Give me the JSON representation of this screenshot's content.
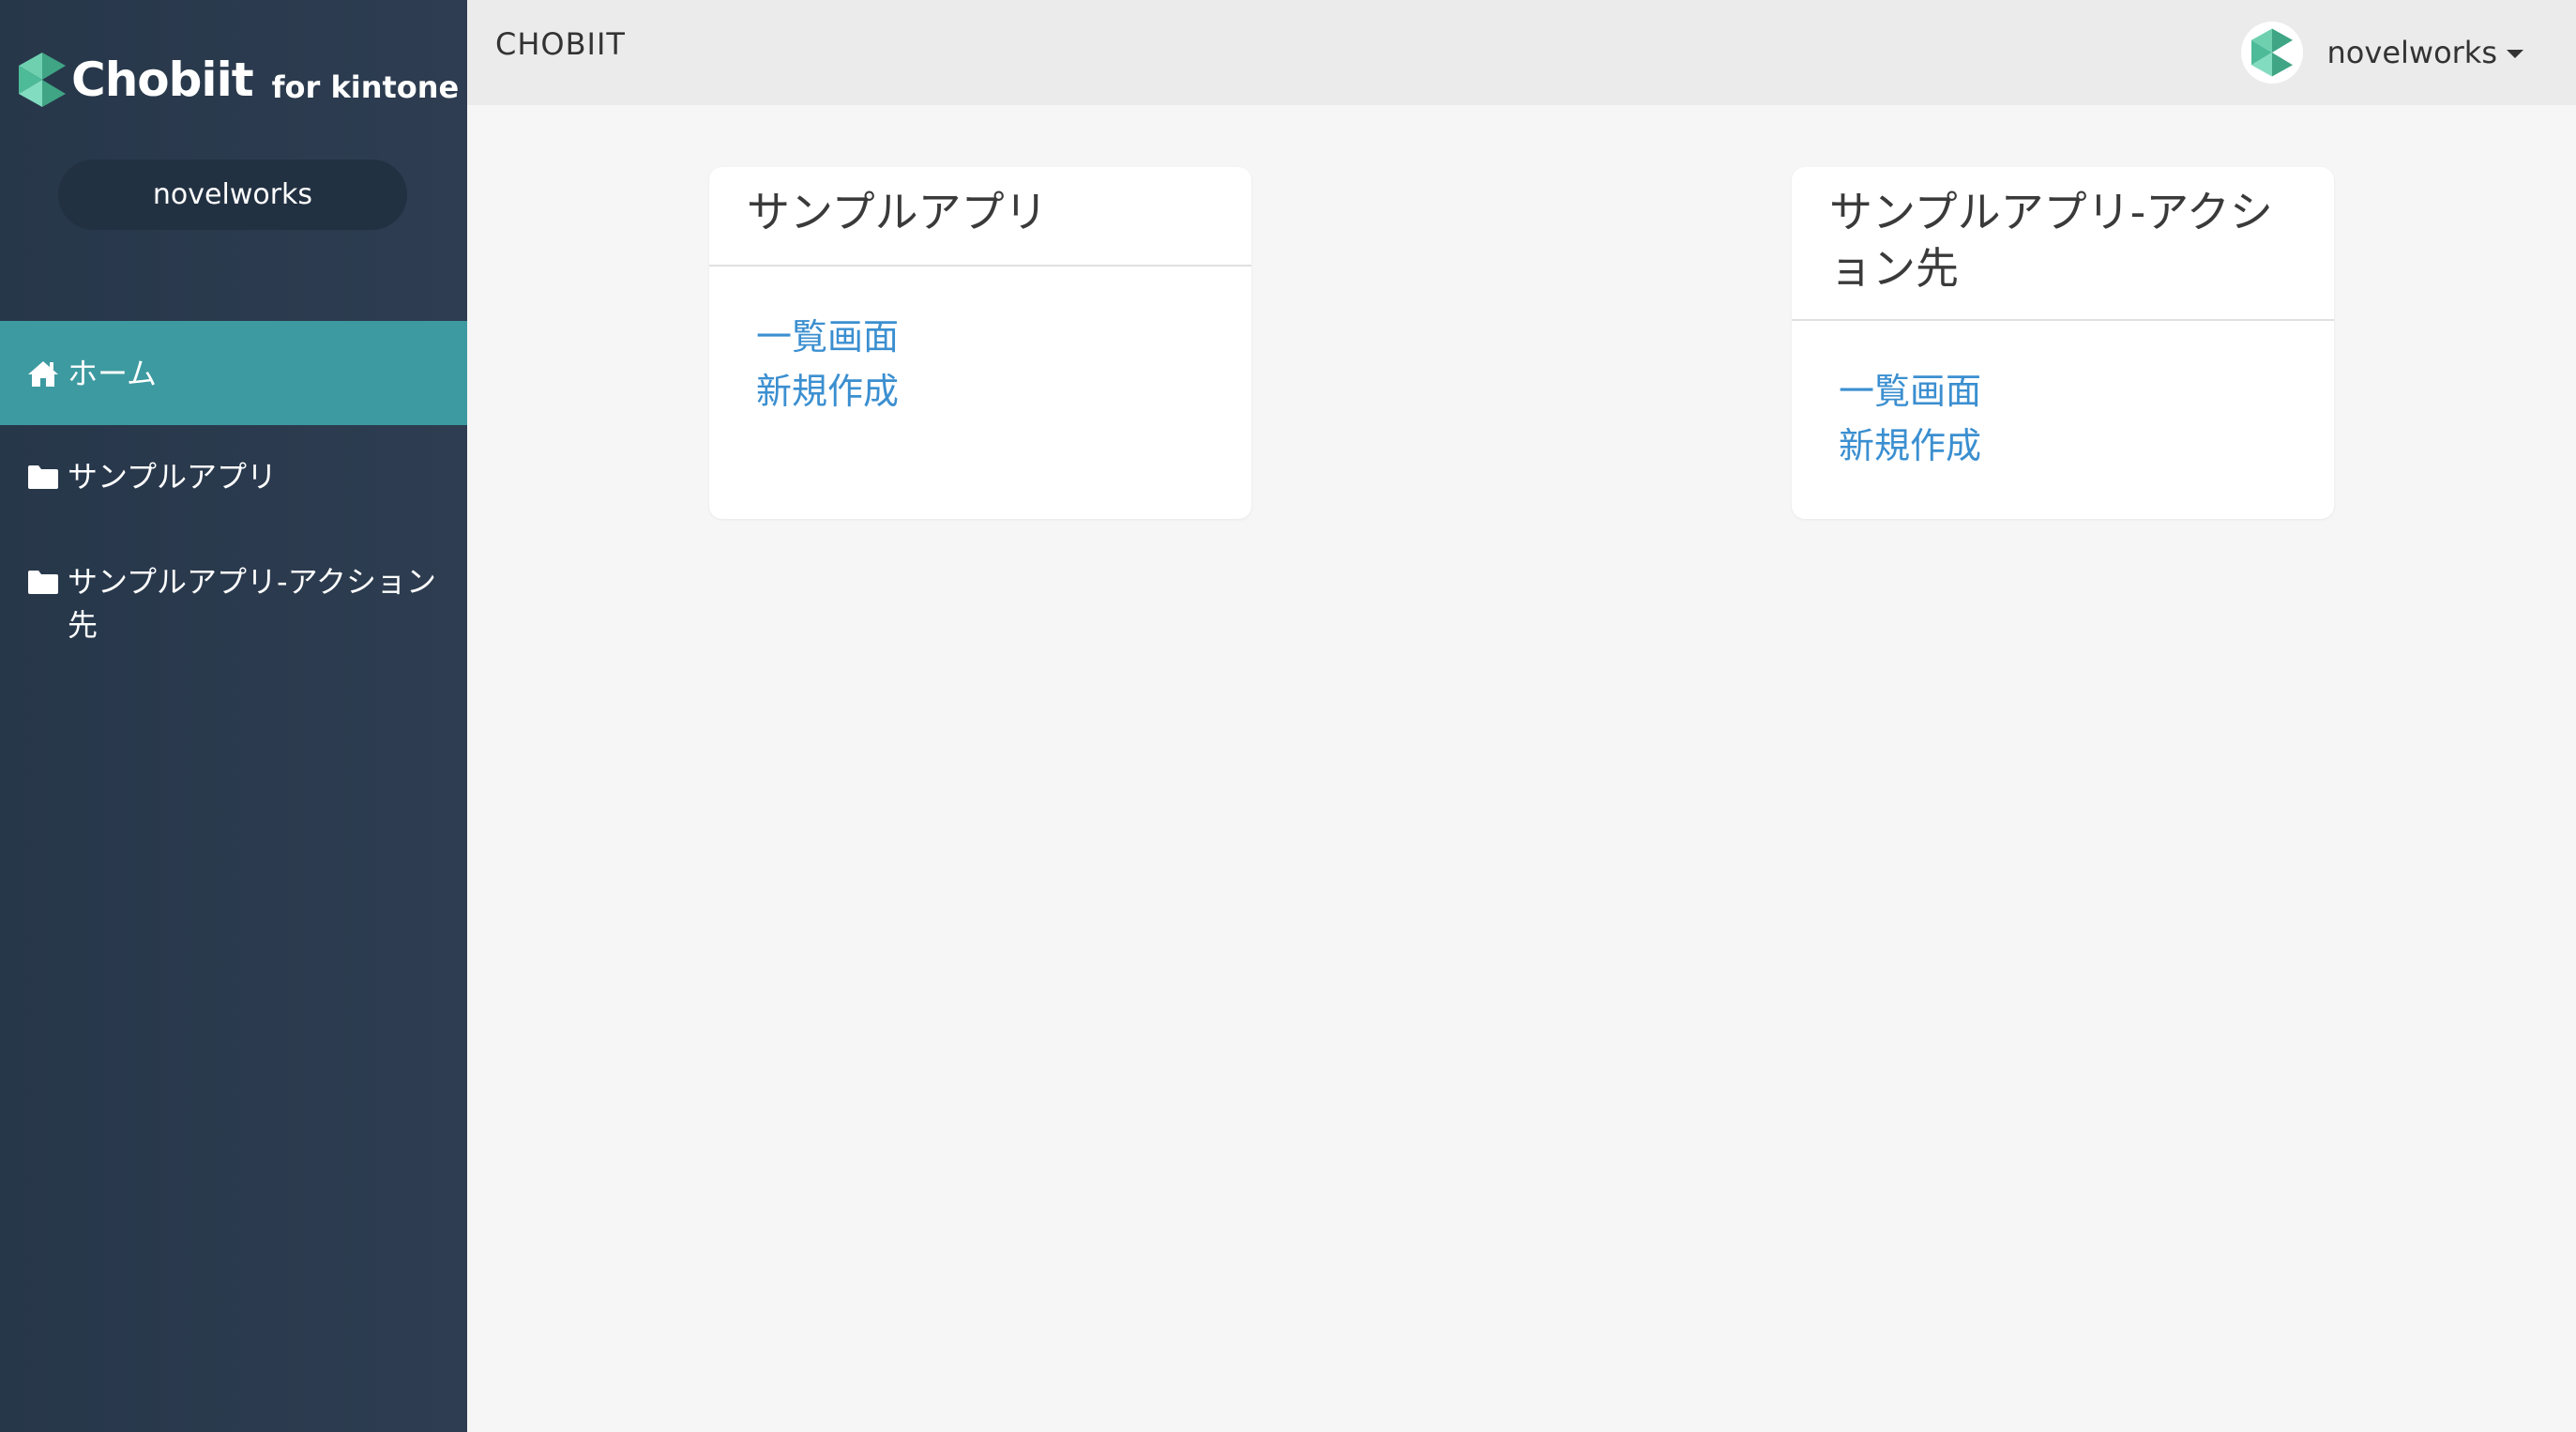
{
  "sidebar": {
    "logo_text": "Chobiit",
    "logo_sub": "for kintone",
    "user_label": "novelworks",
    "items": [
      {
        "label": "ホーム",
        "icon": "home-icon"
      },
      {
        "label": "サンプルアプリ",
        "icon": "folder-icon"
      },
      {
        "label": "サンプルアプリ-アクション先",
        "icon": "folder-icon"
      }
    ]
  },
  "header": {
    "brand": "CHOBIIT",
    "account_name": "novelworks"
  },
  "cards": [
    {
      "title": "サンプルアプリ",
      "links": [
        "一覧画面",
        "新規作成"
      ]
    },
    {
      "title": "サンプルアプリ-アクション先",
      "links": [
        "一覧画面",
        "新規作成"
      ]
    }
  ],
  "colors": {
    "sidebar_bg": "#2e3d51",
    "active_item": "#3d9aa0",
    "header_bg": "#ebebeb",
    "link": "#3b8fd0",
    "logo_green_light": "#6fd0b0",
    "logo_green_dark": "#3fa584"
  }
}
